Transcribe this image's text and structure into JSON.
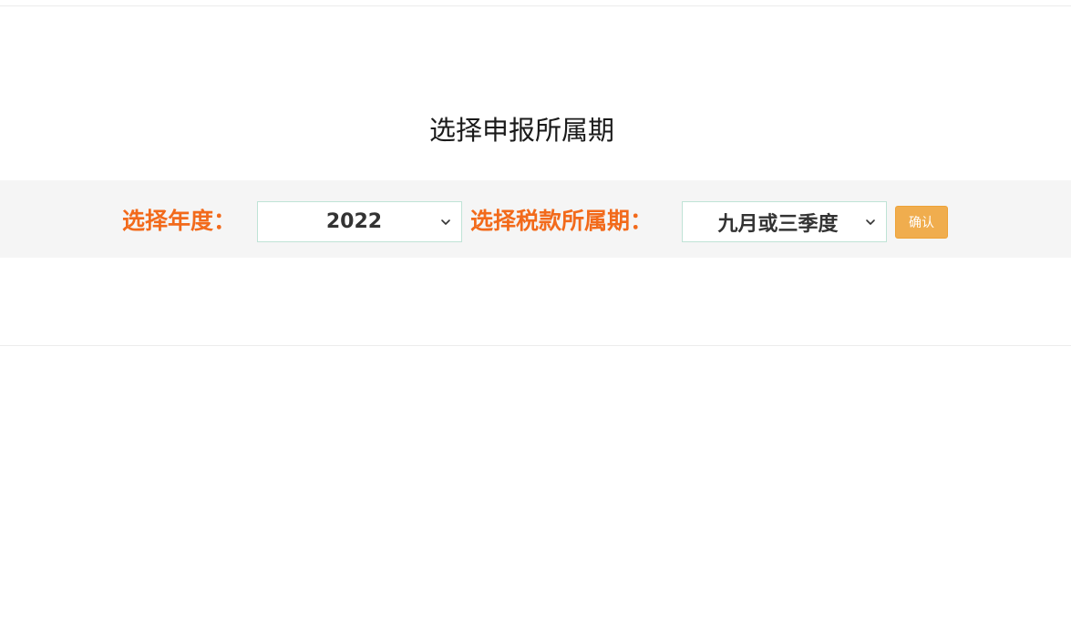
{
  "page": {
    "title": "选择申报所属期"
  },
  "filters": {
    "year_label": "选择年度：",
    "year_value": "2022",
    "period_label": "选择税款所属期：",
    "period_value": "九月或三季度",
    "confirm_label": "确认"
  },
  "icons": {
    "year_dropdown": "chevron-down-icon",
    "period_dropdown": "chevron-down-icon"
  },
  "colors": {
    "label": "#f26a1b",
    "confirm_button": "#f0ad4e",
    "band_background": "#f5f5f5",
    "select_border": "#bfe3d6"
  }
}
